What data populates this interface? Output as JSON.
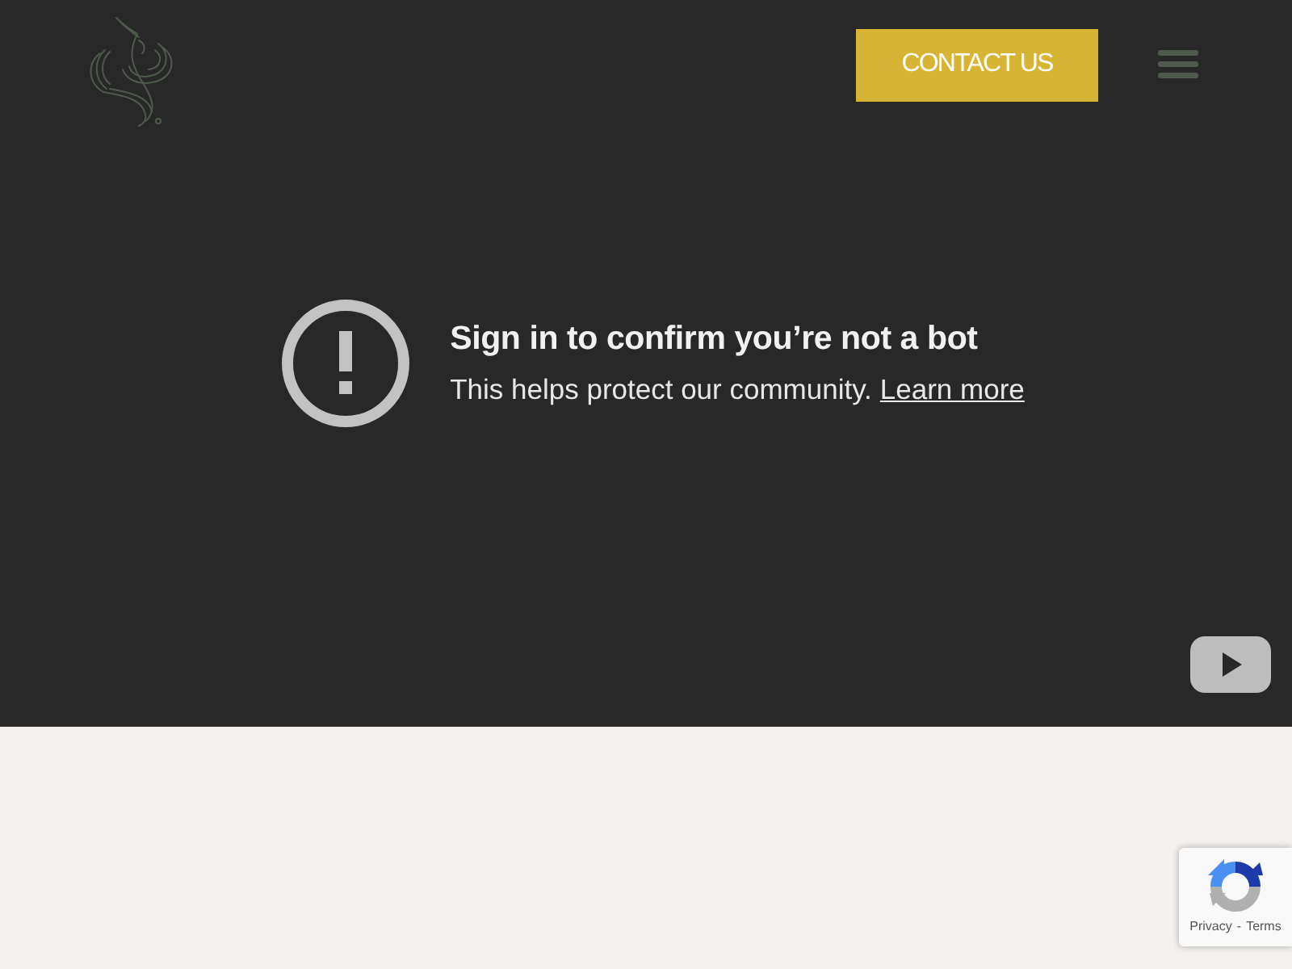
{
  "header": {
    "contact_button": "CONTACT US"
  },
  "video": {
    "title": "Sign in to confirm you’re not a bot",
    "text": "This helps protect our community.",
    "link": "Learn more"
  },
  "recaptcha": {
    "links": [
      "Privacy",
      "Terms"
    ],
    "separator": "-"
  }
}
